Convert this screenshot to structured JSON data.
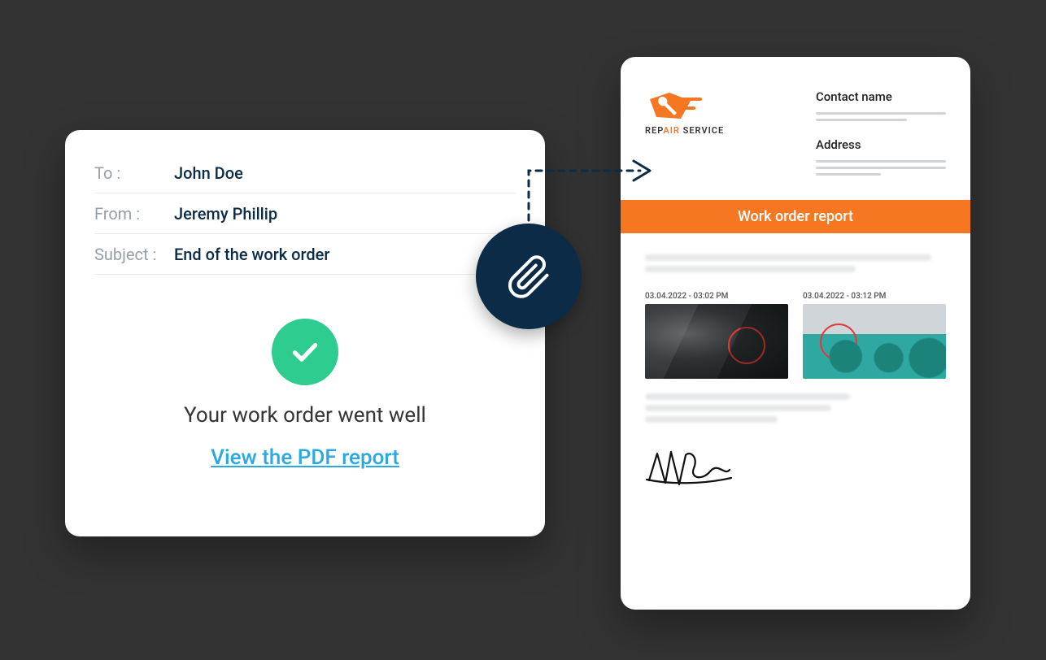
{
  "email": {
    "to_label": "To :",
    "to_value": "John Doe",
    "from_label": "From :",
    "from_value": "Jeremy Phillip",
    "subject_label": "Subject :",
    "subject_value": "End of the work order",
    "message": "Your work order went well",
    "link_label": "View the PDF report"
  },
  "report": {
    "logo_text_1": "REP",
    "logo_text_2": "AIR",
    "logo_text_3": " SERVICE",
    "contact_name_label": "Contact name",
    "address_label": "Address",
    "title": "Work order report",
    "photo1_time": "03.04.2022 - 03:02 PM",
    "photo2_time": "03.04.2022 - 03:12 PM"
  },
  "colors": {
    "accent_orange": "#f57722",
    "accent_green": "#2ecc8f",
    "dark_navy": "#0b2b46",
    "link_blue": "#2aa8e0"
  }
}
